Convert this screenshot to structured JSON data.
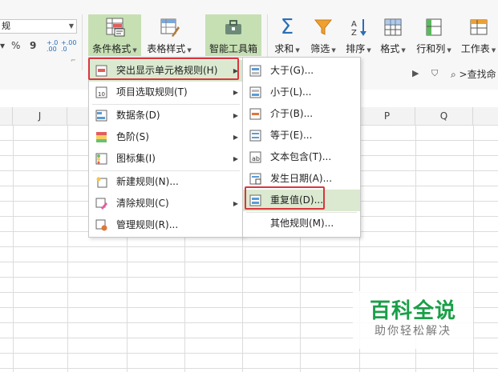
{
  "ribbon": {
    "format_combo": "规",
    "percent": "%",
    "comma": "9",
    "dec_inc": "+.0\n.00",
    "dec_dec": "+.00\n.0",
    "buttons": {
      "cond_format": "条件格式",
      "table_style": "表格样式",
      "smart_toolbox": "智能工具箱",
      "sum": "求和",
      "filter": "筛选",
      "sort": "排序",
      "format": "格式",
      "row_col": "行和列",
      "worksheet": "工作表"
    },
    "search": "查找命"
  },
  "columns": [
    "J",
    "P",
    "Q"
  ],
  "main_menu": {
    "items": [
      {
        "label": "突出显示单元格规则(H)",
        "has_sub": true
      },
      {
        "label": "项目选取规则(T)",
        "has_sub": true
      },
      {
        "label": "数据条(D)",
        "has_sub": true
      },
      {
        "label": "色阶(S)",
        "has_sub": true
      },
      {
        "label": "图标集(I)",
        "has_sub": true
      },
      {
        "label": "新建规则(N)...",
        "has_sub": false
      },
      {
        "label": "清除规则(C)",
        "has_sub": true
      },
      {
        "label": "管理规则(R)...",
        "has_sub": false
      }
    ]
  },
  "sub_menu": {
    "items": [
      {
        "label": "大于(G)..."
      },
      {
        "label": "小于(L)..."
      },
      {
        "label": "介于(B)..."
      },
      {
        "label": "等于(E)..."
      },
      {
        "label": "文本包含(T)..."
      },
      {
        "label": "发生日期(A)..."
      },
      {
        "label": "重复值(D)..."
      },
      {
        "label": "其他规则(M)..."
      }
    ]
  },
  "watermark": {
    "title": "百科全说",
    "subtitle": "助你轻松解决"
  },
  "colors": {
    "accent_green": "#c6e0b4",
    "highlight_red": "#d9363e",
    "brand_green": "#1a9f48"
  }
}
